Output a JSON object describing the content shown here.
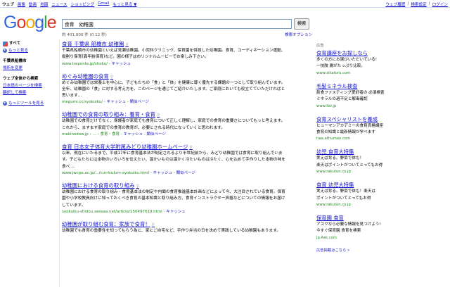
{
  "topbar": {
    "nav": [
      "ウェブ",
      "画像",
      "動画",
      "地図",
      "ニュース",
      "ショッピング",
      "Gmail",
      "もっと見る ▼"
    ],
    "right_links": [
      "ウェブ履歴",
      "検索設定",
      "ログイン"
    ],
    "separator": "|"
  },
  "logo": {
    "text": "Google"
  },
  "search": {
    "query": "食育　幼稚園",
    "button_label": "検索",
    "stats": "約 401,000 件 (0.12 秒)",
    "options_link": "検索オプション"
  },
  "sidebar": {
    "all_label": "すべて",
    "more_label": "もっと見る",
    "location_heading": "千葉県船橋市",
    "location_change": "場所を変更",
    "web_heading": "ウェブ全体から検索",
    "web_options": [
      "日本語のページを検索",
      "翻訳して検索"
    ],
    "more_tools": "もっとツールを見る"
  },
  "results": [
    {
      "title": "食育 千葉県 船橋市 幼稚園",
      "snippet": "千葉県船橋市の幼稚園といえば見瀬幼稚園。小児科クリニック、保育園を併設した幼稚園。食育、コーディネーション運動、縦割り保育(異年齢保育)など。園の様子は市リジナルムービーでお楽しみ下さい。",
      "url": "www.treponte.jp/shoku/",
      "cache": "キャッシュ"
    },
    {
      "title": "めぐみ幼稚園の食育",
      "snippet": "めぐみ幼稚園では栄養士を中心に、子どもたちの「食」と「体」を健康に導く優先する課題の一つとして取り組んでいます。全年、幼稚園の「食」に対する考え方を、このページを通じてご紹介いたします。ご家庭においても役立てていただければと思います...",
      "url": "megumi.cc/syokuiku/",
      "cache": "キャッシュ",
      "similar": "類似ページ"
    },
    {
      "title": "幼稚園での食育の取り組み：養育・食育",
      "snippet": "幼稚園での食育だけでなく、保護者が家庭でも食育について正しく理解し、家庭での食育の重要さについてもっと考えます。これから、ますます家庭での食育の教育が、必要とされる時代になっていくと思われます。",
      "url": "makinodow.jp › ... › 食育・食育",
      "cache": "キャッシュ",
      "similar": "類似ページ"
    },
    {
      "title": "食育 日本女子体育大学附属みどり幼稚園ホームページ",
      "snippet": "以来、現在にいたるまで、平成17年に食育基本法が制定されるより半世紀前から、みどり幼稚園では食育に取り組んでいます。子どもたちには本物のいろいろを伝えたい、温かいものは温かく冷たいものは冷たく、心を込めて手作りした本物の味を食べ ...",
      "url": "www.jwcpe.ac.jp/.../curriculum-syokuiku.html",
      "cache": "キャッシュ",
      "similar": "類似ページ"
    },
    {
      "title": "幼稚園における食育の取り組み",
      "snippet": "幼稚園における食育の取り組み - 食育基本法の制定や内閣の食育推進基本計画などによって今、大注目されている食育。保育園や小学校教員向けに知っておくべき食育の基本知識と取り組み方、食育インストラクター資格などについての情報をお届けしています。",
      "url": "syokuiku-shidou.seesaa.net/article/150497619.html",
      "cache": "キャッシュ"
    },
    {
      "title": "幼稚園が取り組む食育：家族で食育！",
      "snippet": "幼稚園でも食育の重要性を知ってもらう為に、家にご自宅など、手作り弁当の日を決めて実践している幼稚園もあります。",
      "url": "",
      "cache": ""
    }
  ],
  "ads": {
    "heading": "広告",
    "items": [
      {
        "title": "食育講座をお探しなら",
        "lines": [
          "多くの方にお選びいただいている!",
          "一技肢 腸がたっぷり比較。"
        ],
        "url": "www.sikatoru.com"
      },
      {
        "title": "毛髪ミネラル検査",
        "lines": [
          "新食ファスティング愛好者の 必須検査",
          "ミネラルの過不足と解毒確認"
        ],
        "url": "www.lbv.jp"
      },
      {
        "title": "食育スペシャリストを養成",
        "lines": [
          "ヒューマンアカデミーの食育資格講座",
          "食育の知識と最新情報が学べます"
        ],
        "url": "haa.athuman.com"
      },
      {
        "title": "幼児 食育大特集",
        "lines": [
          "実えば背る。野菜で体も！",
          "楽天はポイントがついてとってもお得"
        ],
        "url": "www.rakuten.co.jp"
      },
      {
        "title": "食育 幼児大特集",
        "lines": [
          "実えば背る。野菜で体も！楽天は",
          "ポイントがついてとってもお得"
        ],
        "url": "www.rakuten.co.jp"
      },
      {
        "title": "保育園 食育",
        "lines": [
          "アスクなら必要な情報を見つけよう!",
          "今すぐ保育園 食育を検索"
        ],
        "url": "jp.Ask.com"
      }
    ],
    "footer": "広告掲載はこちら »"
  }
}
